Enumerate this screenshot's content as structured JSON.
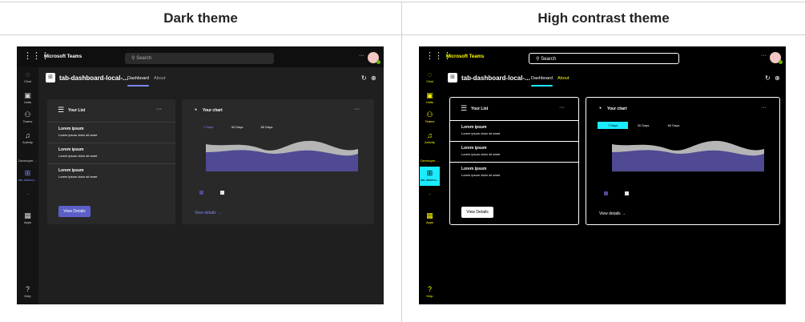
{
  "columns": [
    {
      "heading": "Dark theme"
    },
    {
      "heading": "High contrast theme"
    }
  ],
  "teams": {
    "app_name": "Microsoft Teams",
    "search_placeholder": "Search",
    "more": "···",
    "rail": [
      {
        "label": "Chat",
        "icon": "chat-icon"
      },
      {
        "label": "Units",
        "icon": "units-icon"
      },
      {
        "label": "Teams",
        "icon": "teams-icon"
      },
      {
        "label": "Activity",
        "icon": "bell-icon"
      },
      {
        "label": "Developer ...",
        "icon": ""
      },
      {
        "label": "tab-dashbo...",
        "icon": "apps-tile-icon"
      },
      {
        "label": "···",
        "icon": ""
      },
      {
        "label": "Apps",
        "icon": "apps-icon"
      },
      {
        "label": "Help",
        "icon": "help-icon"
      }
    ],
    "app_title": "tab-dashboard-local-...",
    "tabs": [
      "Dashboard",
      "About"
    ],
    "list_card": {
      "title": "Your List",
      "more": "···",
      "items": [
        {
          "title": "Lorem ipsum",
          "subtitle": "Lorem ipsum dolor sit amet"
        },
        {
          "title": "Lorem ipsum",
          "subtitle": "Lorem ipsum dolor sit amet"
        },
        {
          "title": "Lorem ipsum",
          "subtitle": "Lorem ipsum dolor sit amet"
        }
      ],
      "button": "View Details"
    },
    "chart_card": {
      "title": "Your chart",
      "more": "···",
      "ranges": [
        "7 Days",
        "30 Days",
        "60 Days"
      ],
      "link": "View details →"
    }
  },
  "colors": {
    "dark_bg": "#1f1f1f",
    "dark_accent": "#5b5fc7",
    "hc_accent": "#1aebff",
    "hc_text_link": "#ffff00",
    "series_primary": "#4f4a93",
    "series_secondary": "#b5b5b5"
  }
}
